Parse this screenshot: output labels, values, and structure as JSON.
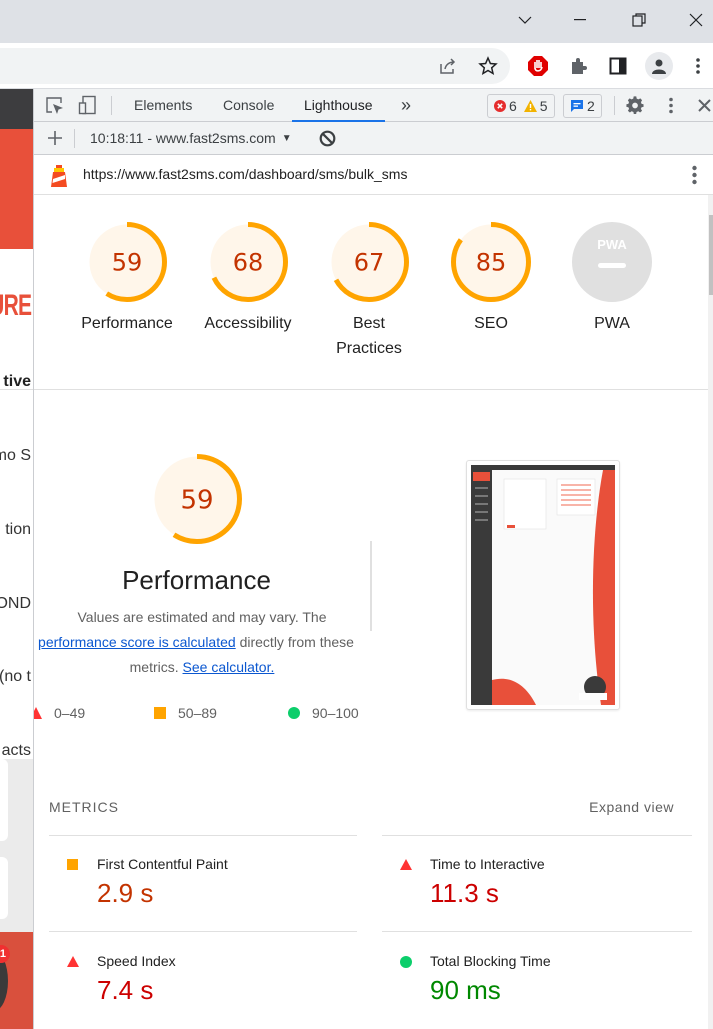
{
  "browser": {
    "window_controls": {
      "tab_search": "chevron-down",
      "minimize": "minimize",
      "restore": "restore",
      "close": "close"
    },
    "toolbar_icons": [
      "share-icon",
      "bookmark-star-icon",
      "adblock-icon",
      "extensions-icon",
      "side-panel-icon",
      "profile-icon",
      "menu-icon"
    ]
  },
  "left_page": {
    "fragments": [
      "URE",
      "tive",
      "mo S",
      "tion",
      "OND",
      "(no t",
      "acts"
    ],
    "notification_count": "1"
  },
  "devtools": {
    "tabs": [
      {
        "label": "Elements",
        "active": false
      },
      {
        "label": "Console",
        "active": false
      },
      {
        "label": "Lighthouse",
        "active": true
      }
    ],
    "more_tabs": "»",
    "errors_count": "6",
    "warnings_count": "5",
    "messages_count": "2",
    "report_selector": "10:18:11 - www.fast2sms.com",
    "report_url": "https://www.fast2sms.com/dashboard/sms/bulk_sms"
  },
  "colors": {
    "average": "#ffa400",
    "average_text": "#c33300",
    "fail": "#ff3333",
    "fail_text": "#cc0000",
    "pass": "#0cce6b",
    "pass_text": "#008800",
    "link": "#0b57d0",
    "fast2sms_red": "#e8503a"
  },
  "categories": [
    {
      "label": "Performance",
      "score": 59
    },
    {
      "label": "Accessibility",
      "score": 68
    },
    {
      "label": "Best Practices",
      "score": 67
    },
    {
      "label": "SEO",
      "score": 85
    },
    {
      "label": "PWA",
      "score": null,
      "badge": "PWA"
    }
  ],
  "performance": {
    "score": 59,
    "title": "Performance",
    "desc_1": "Values are estimated and may vary. The",
    "link_1": "performance score is calculated",
    "desc_2": "directly from these",
    "desc_3": "metrics.",
    "link_2": "See calculator.",
    "legend": [
      {
        "shape": "triangle",
        "range": "0–49"
      },
      {
        "shape": "square",
        "range": "50–89"
      },
      {
        "shape": "circle",
        "range": "90–100"
      }
    ]
  },
  "metrics": {
    "header": "METRICS",
    "expand_label": "Expand view",
    "items": [
      {
        "name": "First Contentful Paint",
        "value": "2.9 s",
        "rating": "average"
      },
      {
        "name": "Time to Interactive",
        "value": "11.3 s",
        "rating": "fail"
      },
      {
        "name": "Speed Index",
        "value": "7.4 s",
        "rating": "fail"
      },
      {
        "name": "Total Blocking Time",
        "value": "90 ms",
        "rating": "pass"
      }
    ]
  }
}
